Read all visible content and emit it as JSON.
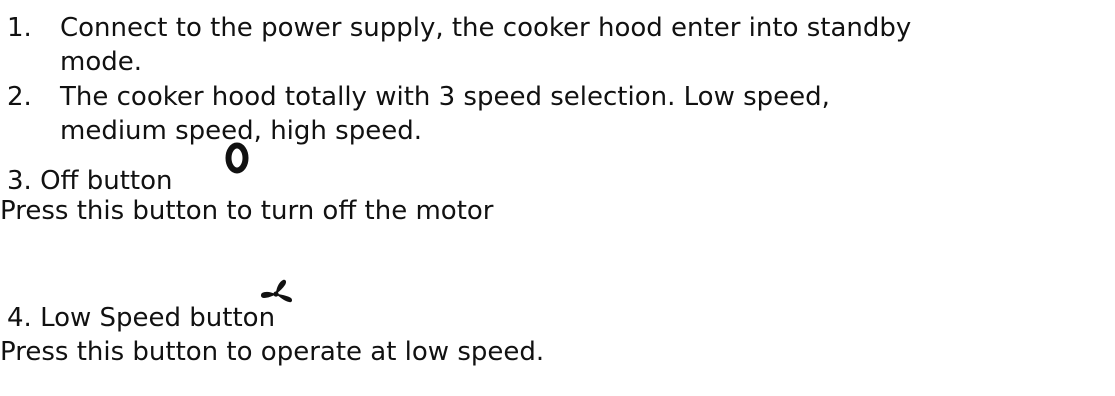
{
  "items": [
    {
      "number": "1.",
      "line1": "Connect to the power supply, the cooker hood enter into standby",
      "line2": "mode."
    },
    {
      "number": "2.",
      "line1": "The cooker hood totally with 3 speed selection. Low speed,",
      "line2": "medium speed, high speed."
    }
  ],
  "off_section": {
    "heading": "3. Off  button",
    "icon": "off-zero-icon",
    "description": "Press this button to turn off the motor"
  },
  "low_speed_section": {
    "heading": "4. Low Speed button",
    "icon": "fan-icon",
    "description": "Press this button to operate at low speed."
  }
}
